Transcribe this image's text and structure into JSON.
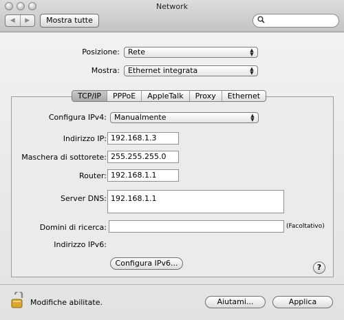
{
  "window": {
    "title": "Network"
  },
  "toolbar": {
    "back_glyph": "◀",
    "forward_glyph": "▶",
    "show_all_label": "Mostra tutte",
    "search_placeholder": ""
  },
  "location": {
    "label": "Posizione:",
    "value": "Rete"
  },
  "show": {
    "label": "Mostra:",
    "value": "Ethernet integrata"
  },
  "tabs": [
    {
      "label": "TCP/IP",
      "active": true
    },
    {
      "label": "PPPoE",
      "active": false
    },
    {
      "label": "AppleTalk",
      "active": false
    },
    {
      "label": "Proxy",
      "active": false
    },
    {
      "label": "Ethernet",
      "active": false
    }
  ],
  "tcpip": {
    "configure_label": "Configura IPv4:",
    "configure_value": "Manualmente",
    "ip_label": "Indirizzo IP:",
    "ip_value": "192.168.1.3",
    "subnet_label": "Maschera di sottorete:",
    "subnet_value": "255.255.255.0",
    "router_label": "Router:",
    "router_value": "192.168.1.1",
    "dns_label": "Server DNS:",
    "dns_value": "192.168.1.1",
    "search_domains_label": "Domini di ricerca:",
    "search_domains_value": "",
    "optional_hint": "(Facoltativo)",
    "ipv6_label": "Indirizzo IPv6:",
    "ipv6_value": "",
    "configure_ipv6_button": "Configura IPv6..."
  },
  "help_glyph": "?",
  "footer": {
    "lock_status": "Modifiche abilitate.",
    "assist_button": "Aiutami...",
    "apply_button": "Applica"
  },
  "colors": {
    "lock_body": "#d9a62e",
    "lock_shackle": "#8a8a8a"
  }
}
